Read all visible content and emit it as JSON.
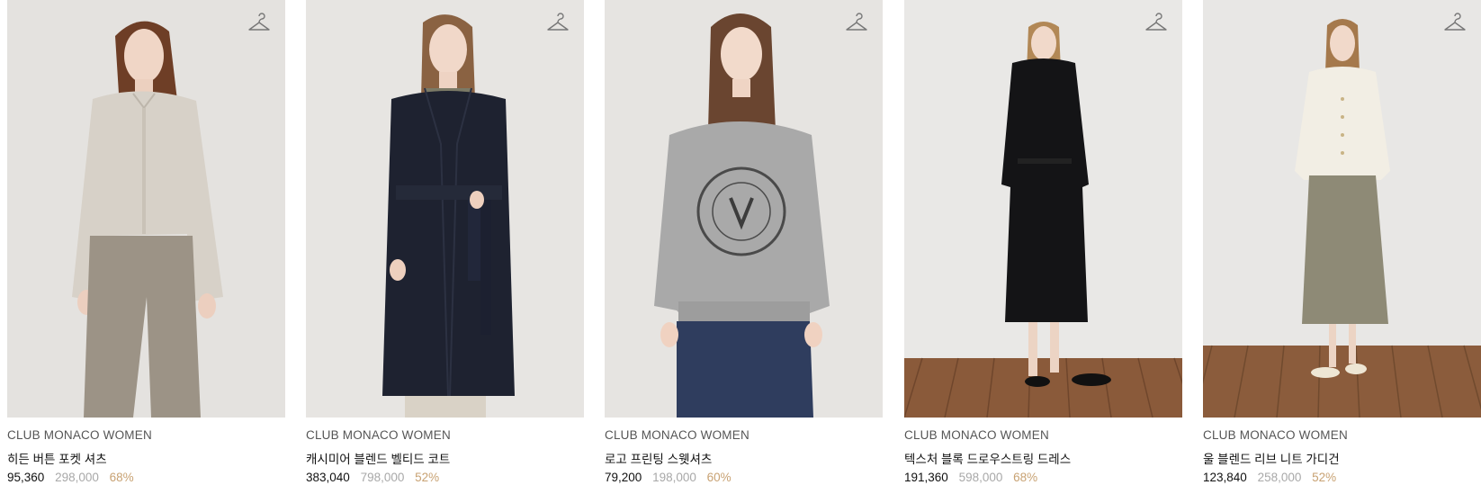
{
  "products": [
    {
      "brand": "CLUB MONACO WOMEN",
      "name": "히든 버튼 포켓 셔츠",
      "price": "95,360",
      "original_price": "298,000",
      "discount": "68%",
      "image_icon": "model-photo-shirt",
      "wishlist_icon": "hanger-icon"
    },
    {
      "brand": "CLUB MONACO WOMEN",
      "name": "캐시미어 블렌드 벨티드 코트",
      "price": "383,040",
      "original_price": "798,000",
      "discount": "52%",
      "image_icon": "model-photo-coat",
      "wishlist_icon": "hanger-icon"
    },
    {
      "brand": "CLUB MONACO WOMEN",
      "name": "로고 프린팅 스웻셔츠",
      "price": "79,200",
      "original_price": "198,000",
      "discount": "60%",
      "image_icon": "model-photo-sweatshirt",
      "wishlist_icon": "hanger-icon"
    },
    {
      "brand": "CLUB MONACO WOMEN",
      "name": "텍스처 블록 드로우스트링 드레스",
      "price": "191,360",
      "original_price": "598,000",
      "discount": "68%",
      "image_icon": "model-photo-dress",
      "wishlist_icon": "hanger-icon"
    },
    {
      "brand": "CLUB MONACO WOMEN",
      "name": "울 블렌드 리브 니트 가디건",
      "price": "123,840",
      "original_price": "258,000",
      "discount": "52%",
      "image_icon": "model-photo-cardigan",
      "wishlist_icon": "hanger-icon"
    }
  ],
  "colors": {
    "price": "#111111",
    "original_price": "#a8a8a8",
    "discount": "#c8a273",
    "brand": "#555555",
    "image_bg": "#e9e7e4"
  }
}
